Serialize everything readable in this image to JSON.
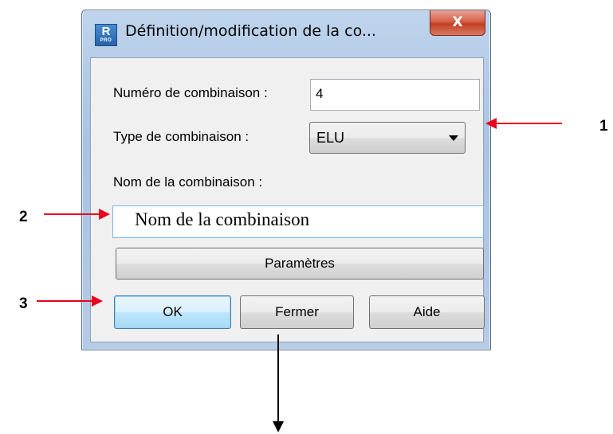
{
  "window": {
    "icon_top": "R",
    "icon_bottom": "PRO",
    "title": "Définition/modification de la co...",
    "close_label": "X"
  },
  "form": {
    "number_label": "Numéro de combinaison :",
    "number_value": "4",
    "type_label": "Type de combinaison :",
    "type_value": "ELU",
    "name_label": "Nom de la combinaison :",
    "name_value": "Nom de la combinaison"
  },
  "buttons": {
    "params": "Paramètres",
    "ok": "OK",
    "close": "Fermer",
    "help": "Aide"
  },
  "annotations": {
    "one": "1",
    "two": "2",
    "three": "3"
  },
  "colors": {
    "annotation_arrow": "#e8001c",
    "down_arrow": "#000000"
  }
}
